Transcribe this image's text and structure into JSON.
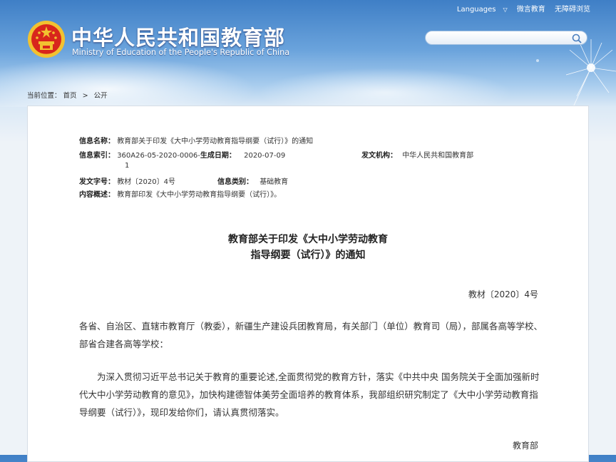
{
  "header": {
    "title_cn": "中华人民共和国教育部",
    "title_en": "Ministry of Education of the People's Republic of China",
    "links": [
      "Languages",
      "微言教育",
      "无障碍浏览"
    ],
    "search_placeholder": ""
  },
  "breadcrumb": {
    "prefix": "当前位置：",
    "home": "首页",
    "sep": ">",
    "current": "公开"
  },
  "meta": {
    "name_label": "信息名称：",
    "name_value": "教育部关于印发《大中小学劳动教育指导纲要（试行）》的通知",
    "index_label": "信息索引：",
    "index_value": "360A26-05-2020-0006-",
    "index_value_cont": "1",
    "date_label": "生成日期：",
    "date_value": "2020-07-09",
    "org_label": "发文机构：",
    "org_value": "中华人民共和国教育部",
    "docno_label": "发文字号：",
    "docno_value": "教材〔2020〕4号",
    "category_label": "信息类别：",
    "category_value": "基础教育",
    "summary_label": "内容概述：",
    "summary_value": "教育部印发《大中小学劳动教育指导纲要（试行）》。"
  },
  "article": {
    "title_line1": "教育部关于印发《大中小学劳动教育",
    "title_line2": "指导纲要（试行）》的通知",
    "doc_number": "教材〔2020〕4号",
    "para1": "各省、自治区、直辖市教育厅（教委），新疆生产建设兵团教育局，有关部门（单位）教育司（局），部属各高等学校、部省合建各高等学校：",
    "para2": "为深入贯彻习近平总书记关于教育的重要论述,全面贯彻党的教育方针，落实《中共中央 国务院关于全面加强新时代大中小学劳动教育的意见》，加快构建德智体美劳全面培养的教育体系，我部组织研究制定了《大中小学劳动教育指导纲要（试行）》，现印发给你们，请认真贯彻落实。",
    "signature": "教育部"
  },
  "colors": {
    "sky_top": "#3f7fc6",
    "emblem_red": "#d8261c",
    "emblem_gold": "#f2c230"
  },
  "icons": {
    "search": "search-icon",
    "emblem": "national-emblem-icon",
    "dropdown": "chevron-down-icon"
  }
}
